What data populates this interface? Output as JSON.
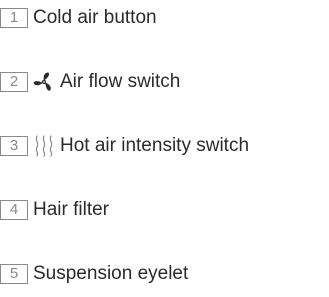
{
  "items": [
    {
      "number": "1",
      "label": "Cold air button"
    },
    {
      "number": "2",
      "label": "Air flow switch",
      "icon": "fan-icon"
    },
    {
      "number": "3",
      "label": "Hot air intensity switch",
      "icon": "heat-waves-icon"
    },
    {
      "number": "4",
      "label": "Hair filter"
    },
    {
      "number": "5",
      "label": "Suspension eyelet"
    }
  ],
  "colors": {
    "text": "#2b2b2b",
    "number_box": "#8a8a8a"
  }
}
